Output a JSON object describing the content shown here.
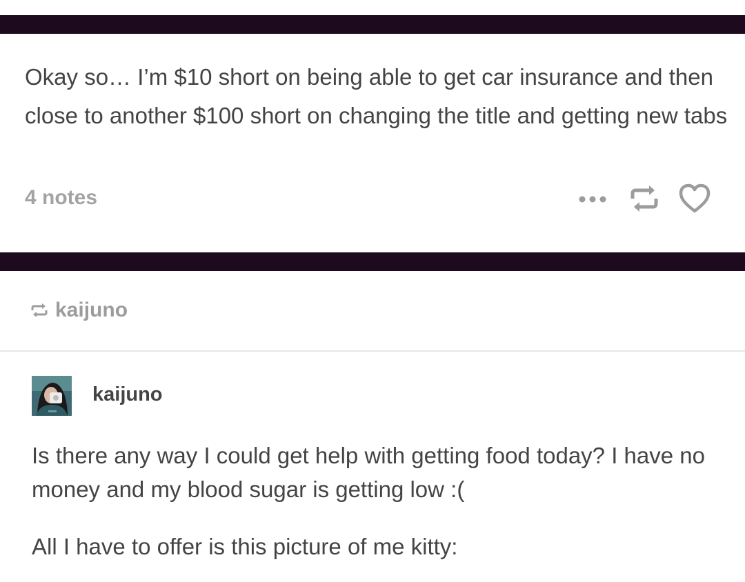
{
  "post_top": {
    "body": "Okay so… I’m $10 short on being able to get car insurance and then close to another $100 short on changing the title and getting new tabs",
    "notes_label": "4 notes",
    "actions": {
      "more_icon": "more-dots-icon",
      "reblog_icon": "reblog-icon",
      "like_icon": "heart-icon"
    }
  },
  "post_reblog": {
    "reblogged_from": "kaijuno",
    "author": {
      "username": "kaijuno",
      "avatar_icon": "user-avatar"
    },
    "paragraphs": [
      "Is there any way I could get help with getting food today? I have no money and my blood sugar is getting low :(",
      "All I have to offer is this picture of me kitty:"
    ]
  },
  "colors": {
    "divider_bar": "#1e0a1e",
    "text": "#444444",
    "muted": "#a3a3a3",
    "icon": "#9c9c9c"
  }
}
